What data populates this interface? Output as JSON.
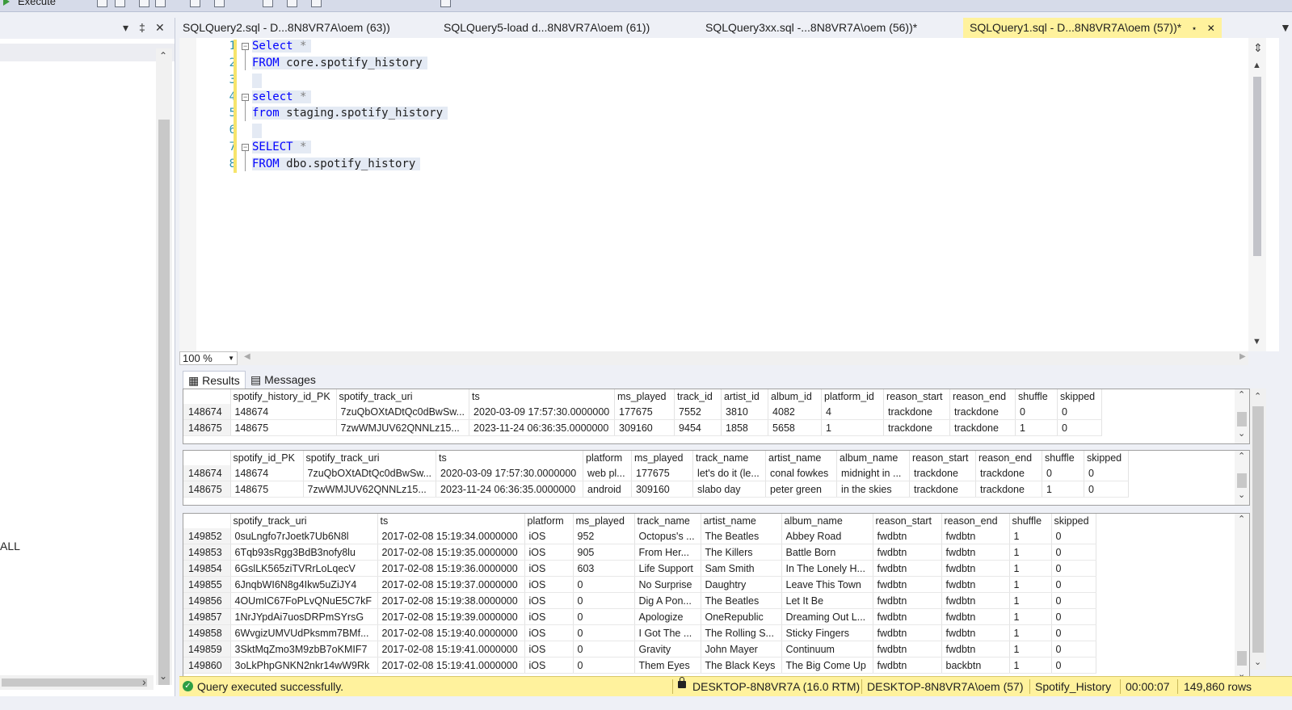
{
  "toolbar": {
    "execute_label": "Execute"
  },
  "left_panel": {
    "tree_label": "ALL",
    "dropdown_icon": "▾",
    "pin_icon": "‡",
    "close_icon": "✕"
  },
  "tabs": [
    {
      "label": "SQLQuery2.sql - D...8N8VR7A\\oem (63))",
      "active": false
    },
    {
      "label": "SQLQuery5-load d...8N8VR7A\\oem (61))",
      "active": false
    },
    {
      "label": "SQLQuery3xx.sql -...8N8VR7A\\oem (56))*",
      "active": false
    },
    {
      "label": "SQLQuery1.sql - D...8N8VR7A\\oem (57))*",
      "active": true
    }
  ],
  "editor": {
    "line_numbers": [
      "1",
      "2",
      "3",
      "4",
      "5",
      "6",
      "7",
      "8"
    ],
    "lines": [
      {
        "kw": "Select",
        "rest": " *",
        "obj": ""
      },
      {
        "kw": "FROM",
        "rest": " ",
        "obj": "core.spotify_history"
      },
      {
        "kw": "",
        "rest": "",
        "obj": ""
      },
      {
        "kw": "select",
        "rest": " *",
        "obj": ""
      },
      {
        "kw": "from",
        "rest": " ",
        "obj": "staging.spotify_history"
      },
      {
        "kw": "",
        "rest": "",
        "obj": ""
      },
      {
        "kw": "SELECT",
        "rest": " *",
        "obj": ""
      },
      {
        "kw": "FROM",
        "rest": " ",
        "obj": "dbo.spotify_history"
      }
    ]
  },
  "zoom": {
    "value": "100 %"
  },
  "result_tabs": {
    "results": "Results",
    "messages": "Messages"
  },
  "grid1": {
    "headers": [
      "",
      "spotify_history_id_PK",
      "spotify_track_uri",
      "ts",
      "ms_played",
      "track_id",
      "artist_id",
      "album_id",
      "platform_id",
      "reason_start",
      "reason_end",
      "shuffle",
      "skipped"
    ],
    "rows": [
      [
        "148674",
        "148674",
        "7zuQbOXtADtQc0dBwSw...",
        "2020-03-09 17:57:30.0000000",
        "177675",
        "7552",
        "3810",
        "4082",
        "4",
        "trackdone",
        "trackdone",
        "0",
        "0"
      ],
      [
        "148675",
        "148675",
        "7zwWMJUV62QNNLz15...",
        "2023-11-24 06:36:35.0000000",
        "309160",
        "9454",
        "1858",
        "5658",
        "1",
        "trackdone",
        "trackdone",
        "1",
        "0"
      ]
    ]
  },
  "grid2": {
    "headers": [
      "",
      "spotify_id_PK",
      "spotify_track_uri",
      "ts",
      "platform",
      "ms_played",
      "track_name",
      "artist_name",
      "album_name",
      "reason_start",
      "reason_end",
      "shuffle",
      "skipped"
    ],
    "rows": [
      [
        "148674",
        "148674",
        "7zuQbOXtADtQc0dBwSw...",
        "2020-03-09 17:57:30.0000000",
        "web pl...",
        "177675",
        "let's do it (le...",
        "conal fowkes",
        "midnight in ...",
        "trackdone",
        "trackdone",
        "0",
        "0"
      ],
      [
        "148675",
        "148675",
        "7zwWMJUV62QNNLz15...",
        "2023-11-24 06:36:35.0000000",
        "android",
        "309160",
        "slabo day",
        "peter green",
        "in the skies",
        "trackdone",
        "trackdone",
        "1",
        "0"
      ]
    ]
  },
  "grid3": {
    "headers": [
      "",
      "spotify_track_uri",
      "ts",
      "platform",
      "ms_played",
      "track_name",
      "artist_name",
      "album_name",
      "reason_start",
      "reason_end",
      "shuffle",
      "skipped"
    ],
    "rows": [
      [
        "149852",
        "0suLngfo7rJoetk7Ub6N8l",
        "2017-02-08 15:19:34.0000000",
        "iOS",
        "952",
        "Octopus's ...",
        "The Beatles",
        "Abbey Road",
        "fwdbtn",
        "fwdbtn",
        "1",
        "0"
      ],
      [
        "149853",
        "6Tqb93sRgg3BdB3nofy8lu",
        "2017-02-08 15:19:35.0000000",
        "iOS",
        "905",
        "From Her...",
        "The Killers",
        "Battle Born",
        "fwdbtn",
        "fwdbtn",
        "1",
        "0"
      ],
      [
        "149854",
        "6GslLK565ziTVRrLoLqecV",
        "2017-02-08 15:19:36.0000000",
        "iOS",
        "603",
        "Life Support",
        "Sam Smith",
        "In The Lonely H...",
        "fwdbtn",
        "fwdbtn",
        "1",
        "0"
      ],
      [
        "149855",
        "6JnqbWI6N8g4Ikw5uZiJY4",
        "2017-02-08 15:19:37.0000000",
        "iOS",
        "0",
        "No Surprise",
        "Daughtry",
        "Leave This Town",
        "fwdbtn",
        "fwdbtn",
        "1",
        "0"
      ],
      [
        "149856",
        "4OUmIC67FoPLvQNuE5C7kF",
        "2017-02-08 15:19:38.0000000",
        "iOS",
        "0",
        "Dig A Pon...",
        "The Beatles",
        "Let It Be",
        "fwdbtn",
        "fwdbtn",
        "1",
        "0"
      ],
      [
        "149857",
        "1NrJYpdAi7uosDRPmSYrsG",
        "2017-02-08 15:19:39.0000000",
        "iOS",
        "0",
        "Apologize",
        "OneRepublic",
        "Dreaming Out L...",
        "fwdbtn",
        "fwdbtn",
        "1",
        "0"
      ],
      [
        "149858",
        "6WvgizUMVUdPksmm7BMf...",
        "2017-02-08 15:19:40.0000000",
        "iOS",
        "0",
        "I Got The ...",
        "The Rolling S...",
        "Sticky Fingers",
        "fwdbtn",
        "fwdbtn",
        "1",
        "0"
      ],
      [
        "149859",
        "3SktMqZmo3M9zbB7oKMIF7",
        "2017-02-08 15:19:41.0000000",
        "iOS",
        "0",
        "Gravity",
        "John Mayer",
        "Continuum",
        "fwdbtn",
        "fwdbtn",
        "1",
        "0"
      ],
      [
        "149860",
        "3oLkPhpGNKN2nkr14wW9Rk",
        "2017-02-08 15:19:41.0000000",
        "iOS",
        "0",
        "Them Eyes",
        "The Black Keys",
        "The Big Come Up",
        "fwdbtn",
        "backbtn",
        "1",
        "0"
      ]
    ]
  },
  "status": {
    "message": "Query executed successfully.",
    "server": "DESKTOP-8N8VR7A (16.0 RTM)",
    "login": "DESKTOP-8N8VR7A\\oem (57)",
    "database": "Spotify_History",
    "elapsed": "00:00:07",
    "rows": "149,860 rows"
  },
  "colors": {
    "status_bar": "#fff29d",
    "keyword": "#0000ff",
    "line_number": "#2b91af",
    "success": "#2e9e44"
  }
}
